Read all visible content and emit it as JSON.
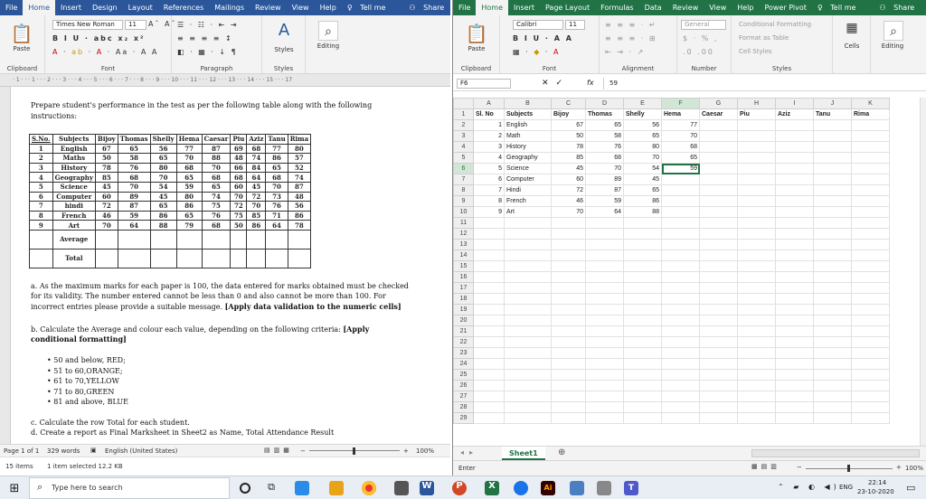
{
  "word": {
    "tabs": [
      "File",
      "Home",
      "Insert",
      "Design",
      "Layout",
      "References",
      "Mailings",
      "Review",
      "View",
      "Help"
    ],
    "tell_me": "Tell me",
    "share": "Share",
    "font_name": "Times New Roman",
    "font_size": "11",
    "groups": {
      "clipboard": "Clipboard",
      "font": "Font",
      "paragraph": "Paragraph",
      "styles": "Styles",
      "editing": "Editing"
    },
    "paste": "Paste",
    "styles_btn": "Styles",
    "editing_btn": "Editing",
    "ruler_text": "· 1 · · · 1 · · · 2 · · · 3 · · · 4 · · · 5 · · · 6 · · · 7 · · · 8 · · · 9 · · · 10 · · · 11 · · · 12 · · · 13 · · · 14 · · · 15 · · · 17",
    "intro_line1": "Prepare student's performance in the test as per the following table along with the following",
    "intro_line2": "instructions:",
    "table_headers": [
      "S.No.",
      "Subjects",
      "Bijoy",
      "Thomas",
      "Shelly",
      "Hema",
      "Caesar",
      "Piu",
      "Aziz",
      "Tanu",
      "Rima"
    ],
    "table_rows": [
      [
        "1",
        "English",
        "67",
        "65",
        "56",
        "77",
        "87",
        "69",
        "68",
        "77",
        "80"
      ],
      [
        "2",
        "Maths",
        "50",
        "58",
        "65",
        "70",
        "88",
        "48",
        "74",
        "86",
        "57"
      ],
      [
        "3",
        "History",
        "78",
        "76",
        "80",
        "68",
        "70",
        "66",
        "84",
        "65",
        "52"
      ],
      [
        "4",
        "Geography",
        "85",
        "68",
        "70",
        "65",
        "68",
        "68",
        "64",
        "68",
        "74"
      ],
      [
        "5",
        "Science",
        "45",
        "70",
        "54",
        "59",
        "65",
        "60",
        "45",
        "70",
        "87"
      ],
      [
        "6",
        "Computer",
        "60",
        "89",
        "45",
        "80",
        "74",
        "70",
        "72",
        "73",
        "48"
      ],
      [
        "7",
        "hindi",
        "72",
        "87",
        "65",
        "86",
        "75",
        "72",
        "70",
        "76",
        "56"
      ],
      [
        "8",
        "French",
        "46",
        "59",
        "86",
        "65",
        "76",
        "75",
        "85",
        "71",
        "86"
      ],
      [
        "9",
        "Art",
        "70",
        "64",
        "88",
        "79",
        "68",
        "50",
        "86",
        "64",
        "78"
      ]
    ],
    "average_label": "Average",
    "total_label": "Total",
    "para_a1": "a. As the maximum marks for each paper is 100, the data entered for marks obtained must be checked",
    "para_a2": "for its validity. The number entered cannot be less than 0 and also cannot be more than 100. For",
    "para_a3": "incorrect entries please provide a suitable message.",
    "para_a3_bold": "[Apply data validation to the numeric cells]",
    "para_b1": "b. Calculate the Average and colour each value, depending on the following criteria:",
    "para_b1_bold": "[Apply",
    "para_b2_bold": "conditional formatting]",
    "bullets": [
      "50 and below, RED;",
      "51 to 60,ORANGE;",
      "61 to 70,YELLOW",
      "71 to 80,GREEN",
      "81 and above, BLUE"
    ],
    "para_c": "c. Calculate the row Total for each student.",
    "para_d": "d. Create a report as Final Marksheet in Sheet2 as Name, Total Attendance Result",
    "status_page": "Page 1 of 1",
    "status_words": "329 words",
    "status_lang": "English (United States)",
    "zoom": "100%",
    "explorer_items": "15 items",
    "explorer_sel": "1 item selected  12.2 KB"
  },
  "excel": {
    "tabs": [
      "File",
      "Home",
      "Insert",
      "Page Layout",
      "Formulas",
      "Data",
      "Review",
      "View",
      "Help",
      "Power Pivot"
    ],
    "tell_me": "Tell me",
    "share": "Share",
    "font_name": "Calibri",
    "font_size": "11",
    "number_format": "General",
    "groups": {
      "clipboard": "Clipboard",
      "font": "Font",
      "alignment": "Alignment",
      "number": "Number",
      "styles": "Styles"
    },
    "paste": "Paste",
    "cond_fmt": "Conditional Formatting",
    "fmt_table": "Format as Table",
    "cell_styles": "Cell Styles",
    "cells_btn": "Cells",
    "editing_btn": "Editing",
    "name_box": "F6",
    "formula_value": "59",
    "col_letters": [
      "A",
      "B",
      "C",
      "D",
      "E",
      "F",
      "G",
      "H",
      "I",
      "J",
      "K"
    ],
    "header_row": [
      "Sl. No",
      "Subjects",
      "Bijoy",
      "Thomas",
      "Shelly",
      "Hema",
      "Caesar",
      "Piu",
      "Aziz",
      "Tanu",
      "Rima"
    ],
    "rows": [
      [
        "1",
        "English",
        "67",
        "65",
        "56",
        "77"
      ],
      [
        "2",
        "Math",
        "50",
        "58",
        "65",
        "70"
      ],
      [
        "3",
        "History",
        "78",
        "76",
        "80",
        "68"
      ],
      [
        "4",
        "Geography",
        "85",
        "68",
        "70",
        "65"
      ],
      [
        "5",
        "Science",
        "45",
        "70",
        "54",
        "59"
      ],
      [
        "6",
        "Computer",
        "60",
        "89",
        "45",
        ""
      ],
      [
        "7",
        "Hindi",
        "72",
        "87",
        "65",
        ""
      ],
      [
        "8",
        "French",
        "46",
        "59",
        "86",
        ""
      ],
      [
        "9",
        "Art",
        "70",
        "64",
        "88",
        ""
      ]
    ],
    "total_rows": 29,
    "sheet_tab": "Sheet1",
    "status_mode": "Enter",
    "zoom": "100%"
  },
  "taskbar": {
    "search_placeholder": "Type here to search",
    "time": "22:14",
    "date": "23-10-2020",
    "lang": "ENG"
  },
  "colors": {
    "word_blue": "#2b579a",
    "excel_green": "#217346"
  }
}
